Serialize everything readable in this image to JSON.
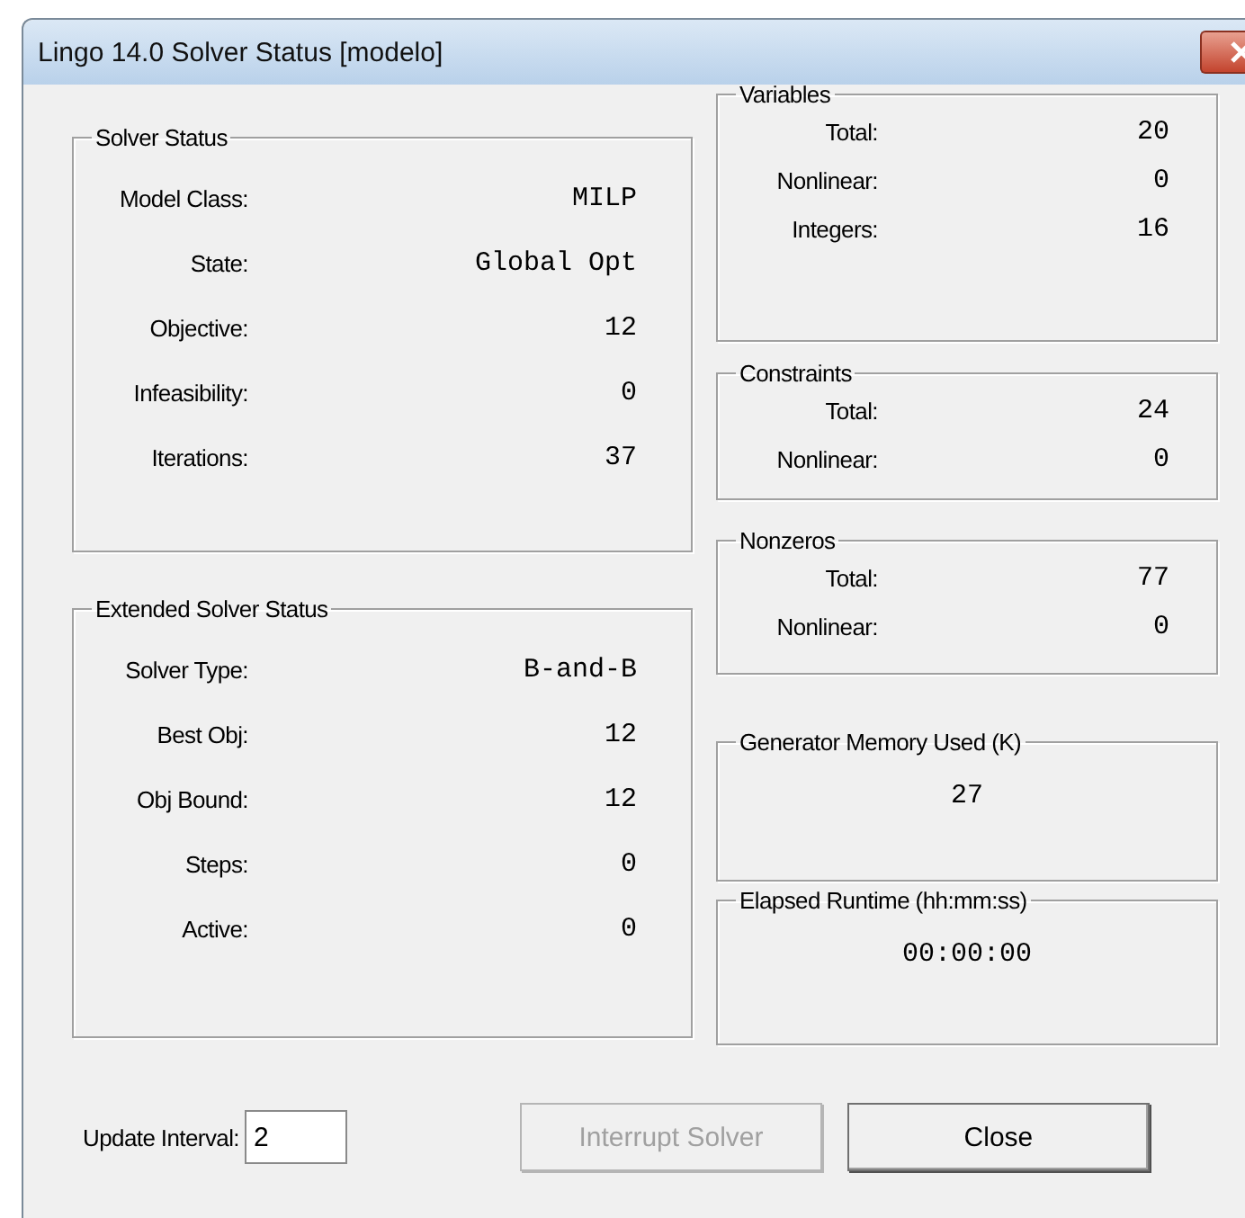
{
  "window": {
    "title": "Lingo 14.0 Solver Status [modelo]"
  },
  "left_groups": [
    {
      "title": "Solver Status",
      "rows": [
        {
          "label": "Model Class:",
          "value": "MILP"
        },
        {
          "label": "State:",
          "value": "Global Opt"
        },
        {
          "label": "Objective:",
          "value": "12"
        },
        {
          "label": "Infeasibility:",
          "value": "0"
        },
        {
          "label": "Iterations:",
          "value": "37"
        }
      ]
    },
    {
      "title": "Extended Solver Status",
      "rows": [
        {
          "label": "Solver Type:",
          "value": "B-and-B"
        },
        {
          "label": "Best Obj:",
          "value": "12"
        },
        {
          "label": "Obj Bound:",
          "value": "12"
        },
        {
          "label": "Steps:",
          "value": "0"
        },
        {
          "label": "Active:",
          "value": "0"
        }
      ]
    }
  ],
  "right_groups": [
    {
      "kind": "table",
      "title": "Variables",
      "rows": [
        {
          "label": "Total:",
          "value": "20"
        },
        {
          "label": "Nonlinear:",
          "value": "0"
        },
        {
          "label": "Integers:",
          "value": "16"
        }
      ]
    },
    {
      "kind": "table",
      "title": "Constraints",
      "rows": [
        {
          "label": "Total:",
          "value": "24"
        },
        {
          "label": "Nonlinear:",
          "value": "0"
        }
      ]
    },
    {
      "kind": "table",
      "title": "Nonzeros",
      "rows": [
        {
          "label": "Total:",
          "value": "77"
        },
        {
          "label": "Nonlinear:",
          "value": "0"
        }
      ]
    },
    {
      "kind": "single",
      "title": "Generator Memory Used (K)",
      "value": "27"
    },
    {
      "kind": "single",
      "title": "Elapsed Runtime (hh:mm:ss)",
      "value": "00:00:00"
    }
  ],
  "update_interval": {
    "label": "Update Interval:",
    "value": "2"
  },
  "buttons": [
    {
      "label": "Interrupt Solver",
      "disabled": true
    },
    {
      "label": "Close",
      "disabled": false
    }
  ]
}
